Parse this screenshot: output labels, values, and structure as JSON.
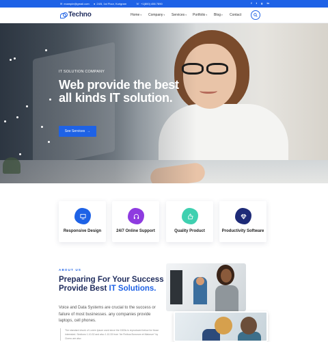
{
  "topbar": {
    "email": "example@gmail.com",
    "address": "24/5, 1st Floor, Kurigram",
    "phone": "+1(800) 456 7890",
    "social": [
      "f",
      "t",
      "g",
      "in"
    ]
  },
  "header": {
    "logo_text": "Techno",
    "nav": [
      {
        "label": "Home",
        "has_dropdown": true
      },
      {
        "label": "Company",
        "has_dropdown": true
      },
      {
        "label": "Services",
        "has_dropdown": true
      },
      {
        "label": "Portfolio",
        "has_dropdown": true
      },
      {
        "label": "Blog",
        "has_dropdown": true
      },
      {
        "label": "Contact",
        "has_dropdown": false
      }
    ]
  },
  "hero": {
    "kicker": "IT SOLUTION COMPANY",
    "title": "Web provide the best all kinds IT solution.",
    "cta_label": "See Services",
    "cta_arrow": "→"
  },
  "services": [
    {
      "label": "Responsive Design",
      "icon": "monitor-icon",
      "color": "#1e62e6"
    },
    {
      "label": "24/7 Online Support",
      "icon": "headphones-icon",
      "color": "#8e3be0"
    },
    {
      "label": "Quality Product",
      "icon": "thumb-icon",
      "color": "#3fd0b0"
    },
    {
      "label": "Productivity Software",
      "icon": "diamond-icon",
      "color": "#1e2b78"
    }
  ],
  "about": {
    "kicker": "ABOUT US",
    "title_line1": "Preparing For Your Success",
    "title_line2_plain": "Provide Best ",
    "title_line2_highlight": "IT Solutions.",
    "paragraph": "Voice and Data Systems are crucial to the success or failure of most businesses. any companies provide laptops, cell phones.",
    "small_text": "The standard chunk of Lorem Ipsum used since the 1500s is reproduced below for those interested. Sections 1.10.32 and also 1.10.33 from \"de Finibus Bonorum et Malorum\" by Cicero are also"
  },
  "colors": {
    "primary": "#1e62e6",
    "dark": "#1e2b5c"
  }
}
